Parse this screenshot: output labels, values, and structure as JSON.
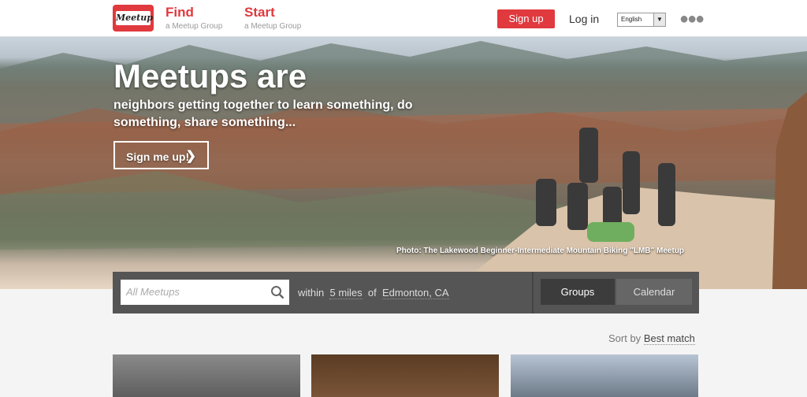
{
  "header": {
    "logo_text": "Meetup",
    "find": {
      "label": "Find",
      "sub": "a Meetup Group"
    },
    "start": {
      "label": "Start",
      "sub": "a Meetup Group"
    },
    "signup": "Sign up",
    "login": "Log in",
    "language": "English",
    "more_icon": "more-dots-icon"
  },
  "hero": {
    "title": "Meetups are",
    "subtitle": "neighbors getting together to learn something, do something, share something...",
    "cta": "Sign me up!",
    "caption": "Photo: The Lakewood Beginner-Intermediate Mountain Biking \"LMB\" Meetup"
  },
  "search": {
    "placeholder": "All Meetups",
    "within": "within",
    "distance": "5 miles",
    "of": "of",
    "location": "Edmonton, CA",
    "tabs": [
      "Groups",
      "Calendar"
    ]
  },
  "sort": {
    "label": "Sort by",
    "value": "Best match"
  },
  "colors": {
    "brand": "#e0393e",
    "searchbar": "#555555"
  }
}
